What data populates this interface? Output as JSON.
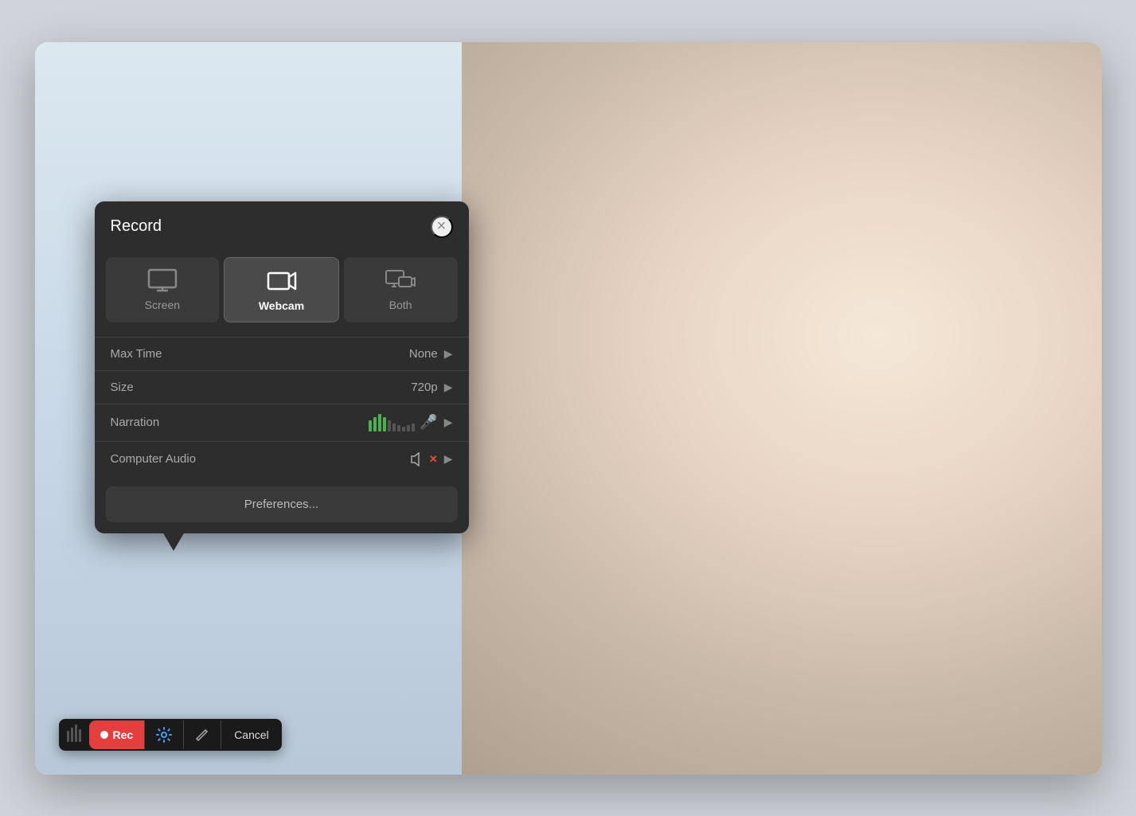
{
  "dialog": {
    "title": "Record",
    "close_label": "×",
    "modes": [
      {
        "id": "screen",
        "label": "Screen",
        "active": false
      },
      {
        "id": "webcam",
        "label": "Webcam",
        "active": true
      },
      {
        "id": "both",
        "label": "Both",
        "active": false
      }
    ],
    "settings": [
      {
        "id": "max-time",
        "label": "Max Time",
        "value": "None"
      },
      {
        "id": "size",
        "label": "Size",
        "value": "720p"
      },
      {
        "id": "narration",
        "label": "Narration",
        "value": ""
      },
      {
        "id": "computer-audio",
        "label": "Computer Audio",
        "value": ""
      }
    ],
    "preferences_label": "Preferences..."
  },
  "toolbar": {
    "rec_label": "Rec",
    "cancel_label": "Cancel"
  }
}
